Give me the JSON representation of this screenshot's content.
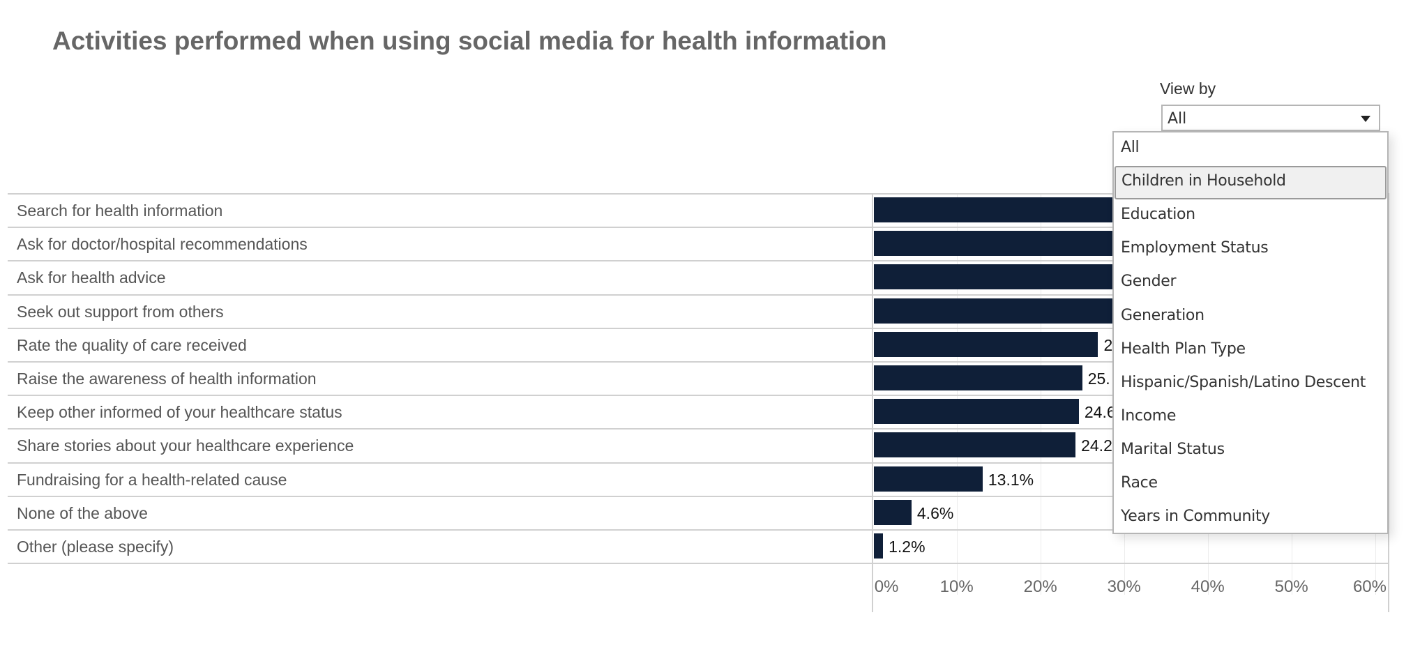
{
  "title": "Activities performed when using social media for health information",
  "filter": {
    "label": "View by",
    "selected": "All",
    "options": [
      "All",
      "Children in Household",
      "Education",
      "Employment Status",
      "Gender",
      "Generation",
      "Health Plan Type",
      "Hispanic/Spanish/Latino Descent",
      "Income",
      "Marital Status",
      "Race",
      "Years in Community"
    ],
    "hovered": "Children in Household",
    "open": true
  },
  "chart_data": {
    "type": "bar",
    "orientation": "horizontal",
    "title": "Activities performed when using social media for health information",
    "xlabel": "",
    "ylabel": "",
    "xlim": [
      0,
      60
    ],
    "x_ticks": [
      "0%",
      "10%",
      "20%",
      "30%",
      "40%",
      "50%",
      "60%"
    ],
    "x_tick_values": [
      0,
      10,
      20,
      30,
      40,
      50,
      60
    ],
    "grid": true,
    "legend": "none",
    "bar_color": "#0f1f38",
    "categories": [
      "Search for health information",
      "Ask for doctor/hospital recommendations",
      "Ask for health advice",
      "Seek out support from others",
      "Rate the quality of care received",
      "Raise the awareness of health information",
      "Keep other informed of your healthcare status",
      "Share stories about your healthcare experience",
      "Fundraising for a health-related cause",
      "None of the above",
      "Other (please specify)"
    ],
    "values": [
      null,
      null,
      null,
      null,
      26.9,
      25.0,
      24.6,
      24.2,
      13.1,
      4.6,
      1.2
    ],
    "value_labels": [
      "",
      "",
      "",
      "",
      "2",
      "25.",
      "24.6",
      "24.2",
      "13.1%",
      "4.6%",
      "1.2%"
    ],
    "note": "Top four bars and some labels are hidden behind the open dropdown; bars extend at least to about 29%."
  }
}
